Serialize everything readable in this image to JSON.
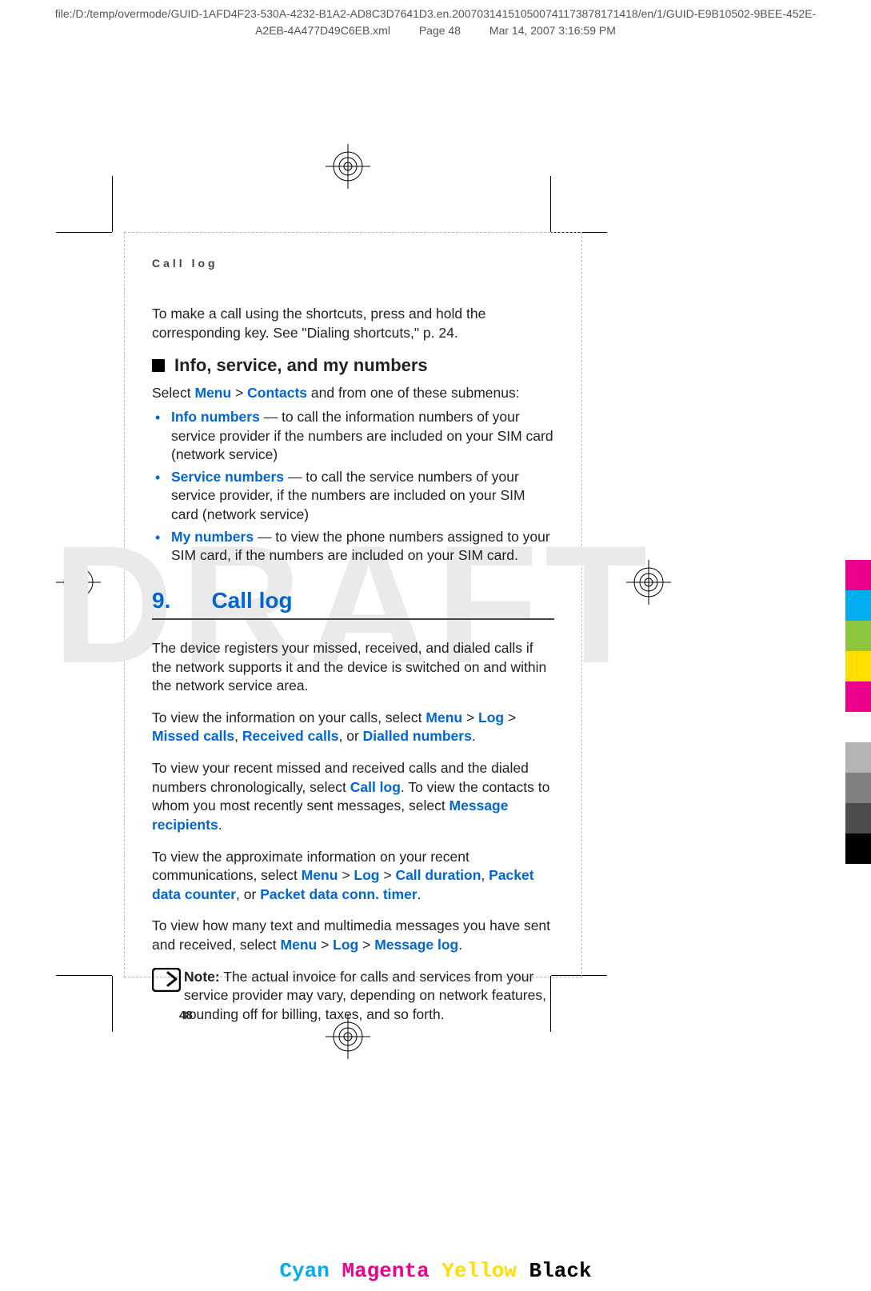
{
  "header": {
    "path_line1": "file:/D:/temp/overmode/GUID-1AFD4F23-530A-4232-B1A2-AD8C3D7641D3.en.20070314151050074117387817141​8/en/1/GUID-E9B10502-9BEE-452E-",
    "path_line2": "A2EB-4A477D49C6EB.xml",
    "page_label": "Page 48",
    "timestamp": "Mar 14, 2007 3:16:59 PM"
  },
  "running_head": "Call log",
  "watermark": "DRAFT",
  "intro": {
    "text_a": "To make a call using the shortcuts, press and hold the corresponding key. See \"Dialing shortcuts,\" p. 24."
  },
  "section_info": {
    "heading": "Info, service, and my numbers",
    "lead_a": "Select ",
    "menu": "Menu",
    "gt1": " > ",
    "contacts": "Contacts",
    "lead_b": " and from one of these submenus:",
    "items": [
      {
        "term": "Info numbers",
        "rest": " —  to call the information numbers of your service provider if the numbers are included on your SIM card (network service)"
      },
      {
        "term": "Service numbers",
        "rest": "  — to call the service numbers of your service provider, if the numbers are included on your SIM card (network service)"
      },
      {
        "term": "My numbers",
        "rest": " —  to view the phone numbers assigned to your SIM card, if the numbers are included on your SIM card."
      }
    ]
  },
  "chapter": {
    "num": "9.",
    "title": "Call log"
  },
  "calllog": {
    "p1": "The device registers your missed, received, and dialed calls if the network supports it and the device is switched on and within the network service area.",
    "p2a": "To view the information on your calls, select ",
    "p2_menu": "Menu",
    "p2_gt1": " > ",
    "p2_log": "Log",
    "p2_gt2": " > ",
    "p2_missed": "Missed calls",
    "p2b": ", ",
    "p2_received": "Received calls",
    "p2c": ", or ",
    "p2_dialled": "Dialled numbers",
    "p2d": ".",
    "p3a": "To view your recent missed and received calls and the dialed numbers chronologically, select ",
    "p3_calllog": "Call log",
    "p3b": ". To view the contacts to whom you most recently sent messages, select ",
    "p3_msgrec": "Message recipients",
    "p3c": ".",
    "p4a": "To view the approximate information on your recent communications, select ",
    "p4_menu": "Menu",
    "p4_gt1": " > ",
    "p4_log": "Log",
    "p4_gt2": " > ",
    "p4_dur": "Call duration",
    "p4b": ", ",
    "p4_pdc": "Packet data counter",
    "p4c": ", or ",
    "p4_pdct": "Packet data conn. timer",
    "p4d": ".",
    "p5a": "To view how many text and multimedia messages you have sent and received, select ",
    "p5_menu": "Menu",
    "p5_gt1": " > ",
    "p5_log": "Log",
    "p5_gt2": " > ",
    "p5_msglog": "Message log",
    "p5b": ".",
    "note_label": "Note:",
    "note_text": "  The actual invoice for calls and services from your service provider may vary, depending on network features, rounding off for billing, taxes, and so forth."
  },
  "page_number": "48",
  "cmyk": {
    "c": "Cyan",
    "m": "Magenta",
    "y": "Yellow",
    "k": "Black"
  },
  "colorbars": [
    "#ec008c",
    "#00aeef",
    "#8dc63f",
    "#ffde00",
    "#ec008c",
    "#ffffff",
    "#b3b3b3",
    "#808080",
    "#4d4d4d",
    "#000000"
  ]
}
